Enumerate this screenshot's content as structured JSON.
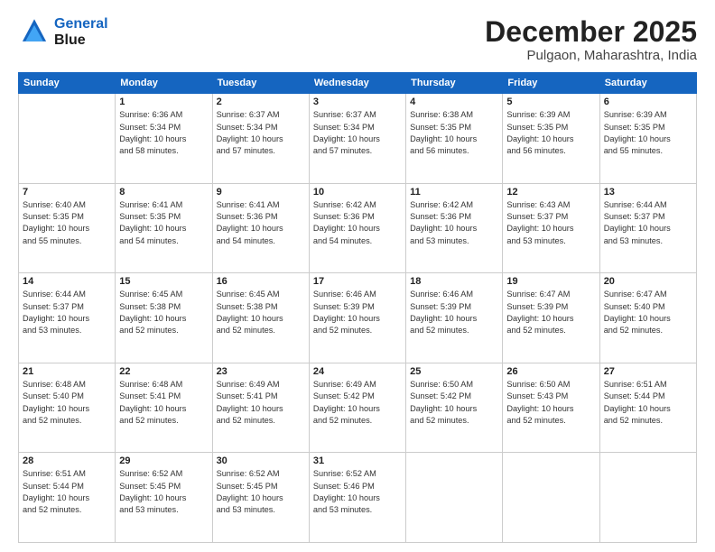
{
  "header": {
    "logo_line1": "General",
    "logo_line2": "Blue",
    "month": "December 2025",
    "location": "Pulgaon, Maharashtra, India"
  },
  "days_of_week": [
    "Sunday",
    "Monday",
    "Tuesday",
    "Wednesday",
    "Thursday",
    "Friday",
    "Saturday"
  ],
  "weeks": [
    [
      {
        "day": "",
        "info": ""
      },
      {
        "day": "1",
        "info": "Sunrise: 6:36 AM\nSunset: 5:34 PM\nDaylight: 10 hours\nand 58 minutes."
      },
      {
        "day": "2",
        "info": "Sunrise: 6:37 AM\nSunset: 5:34 PM\nDaylight: 10 hours\nand 57 minutes."
      },
      {
        "day": "3",
        "info": "Sunrise: 6:37 AM\nSunset: 5:34 PM\nDaylight: 10 hours\nand 57 minutes."
      },
      {
        "day": "4",
        "info": "Sunrise: 6:38 AM\nSunset: 5:35 PM\nDaylight: 10 hours\nand 56 minutes."
      },
      {
        "day": "5",
        "info": "Sunrise: 6:39 AM\nSunset: 5:35 PM\nDaylight: 10 hours\nand 56 minutes."
      },
      {
        "day": "6",
        "info": "Sunrise: 6:39 AM\nSunset: 5:35 PM\nDaylight: 10 hours\nand 55 minutes."
      }
    ],
    [
      {
        "day": "7",
        "info": "Sunrise: 6:40 AM\nSunset: 5:35 PM\nDaylight: 10 hours\nand 55 minutes."
      },
      {
        "day": "8",
        "info": "Sunrise: 6:41 AM\nSunset: 5:35 PM\nDaylight: 10 hours\nand 54 minutes."
      },
      {
        "day": "9",
        "info": "Sunrise: 6:41 AM\nSunset: 5:36 PM\nDaylight: 10 hours\nand 54 minutes."
      },
      {
        "day": "10",
        "info": "Sunrise: 6:42 AM\nSunset: 5:36 PM\nDaylight: 10 hours\nand 54 minutes."
      },
      {
        "day": "11",
        "info": "Sunrise: 6:42 AM\nSunset: 5:36 PM\nDaylight: 10 hours\nand 53 minutes."
      },
      {
        "day": "12",
        "info": "Sunrise: 6:43 AM\nSunset: 5:37 PM\nDaylight: 10 hours\nand 53 minutes."
      },
      {
        "day": "13",
        "info": "Sunrise: 6:44 AM\nSunset: 5:37 PM\nDaylight: 10 hours\nand 53 minutes."
      }
    ],
    [
      {
        "day": "14",
        "info": "Sunrise: 6:44 AM\nSunset: 5:37 PM\nDaylight: 10 hours\nand 53 minutes."
      },
      {
        "day": "15",
        "info": "Sunrise: 6:45 AM\nSunset: 5:38 PM\nDaylight: 10 hours\nand 52 minutes."
      },
      {
        "day": "16",
        "info": "Sunrise: 6:45 AM\nSunset: 5:38 PM\nDaylight: 10 hours\nand 52 minutes."
      },
      {
        "day": "17",
        "info": "Sunrise: 6:46 AM\nSunset: 5:39 PM\nDaylight: 10 hours\nand 52 minutes."
      },
      {
        "day": "18",
        "info": "Sunrise: 6:46 AM\nSunset: 5:39 PM\nDaylight: 10 hours\nand 52 minutes."
      },
      {
        "day": "19",
        "info": "Sunrise: 6:47 AM\nSunset: 5:39 PM\nDaylight: 10 hours\nand 52 minutes."
      },
      {
        "day": "20",
        "info": "Sunrise: 6:47 AM\nSunset: 5:40 PM\nDaylight: 10 hours\nand 52 minutes."
      }
    ],
    [
      {
        "day": "21",
        "info": "Sunrise: 6:48 AM\nSunset: 5:40 PM\nDaylight: 10 hours\nand 52 minutes."
      },
      {
        "day": "22",
        "info": "Sunrise: 6:48 AM\nSunset: 5:41 PM\nDaylight: 10 hours\nand 52 minutes."
      },
      {
        "day": "23",
        "info": "Sunrise: 6:49 AM\nSunset: 5:41 PM\nDaylight: 10 hours\nand 52 minutes."
      },
      {
        "day": "24",
        "info": "Sunrise: 6:49 AM\nSunset: 5:42 PM\nDaylight: 10 hours\nand 52 minutes."
      },
      {
        "day": "25",
        "info": "Sunrise: 6:50 AM\nSunset: 5:42 PM\nDaylight: 10 hours\nand 52 minutes."
      },
      {
        "day": "26",
        "info": "Sunrise: 6:50 AM\nSunset: 5:43 PM\nDaylight: 10 hours\nand 52 minutes."
      },
      {
        "day": "27",
        "info": "Sunrise: 6:51 AM\nSunset: 5:44 PM\nDaylight: 10 hours\nand 52 minutes."
      }
    ],
    [
      {
        "day": "28",
        "info": "Sunrise: 6:51 AM\nSunset: 5:44 PM\nDaylight: 10 hours\nand 52 minutes."
      },
      {
        "day": "29",
        "info": "Sunrise: 6:52 AM\nSunset: 5:45 PM\nDaylight: 10 hours\nand 53 minutes."
      },
      {
        "day": "30",
        "info": "Sunrise: 6:52 AM\nSunset: 5:45 PM\nDaylight: 10 hours\nand 53 minutes."
      },
      {
        "day": "31",
        "info": "Sunrise: 6:52 AM\nSunset: 5:46 PM\nDaylight: 10 hours\nand 53 minutes."
      },
      {
        "day": "",
        "info": ""
      },
      {
        "day": "",
        "info": ""
      },
      {
        "day": "",
        "info": ""
      }
    ]
  ]
}
